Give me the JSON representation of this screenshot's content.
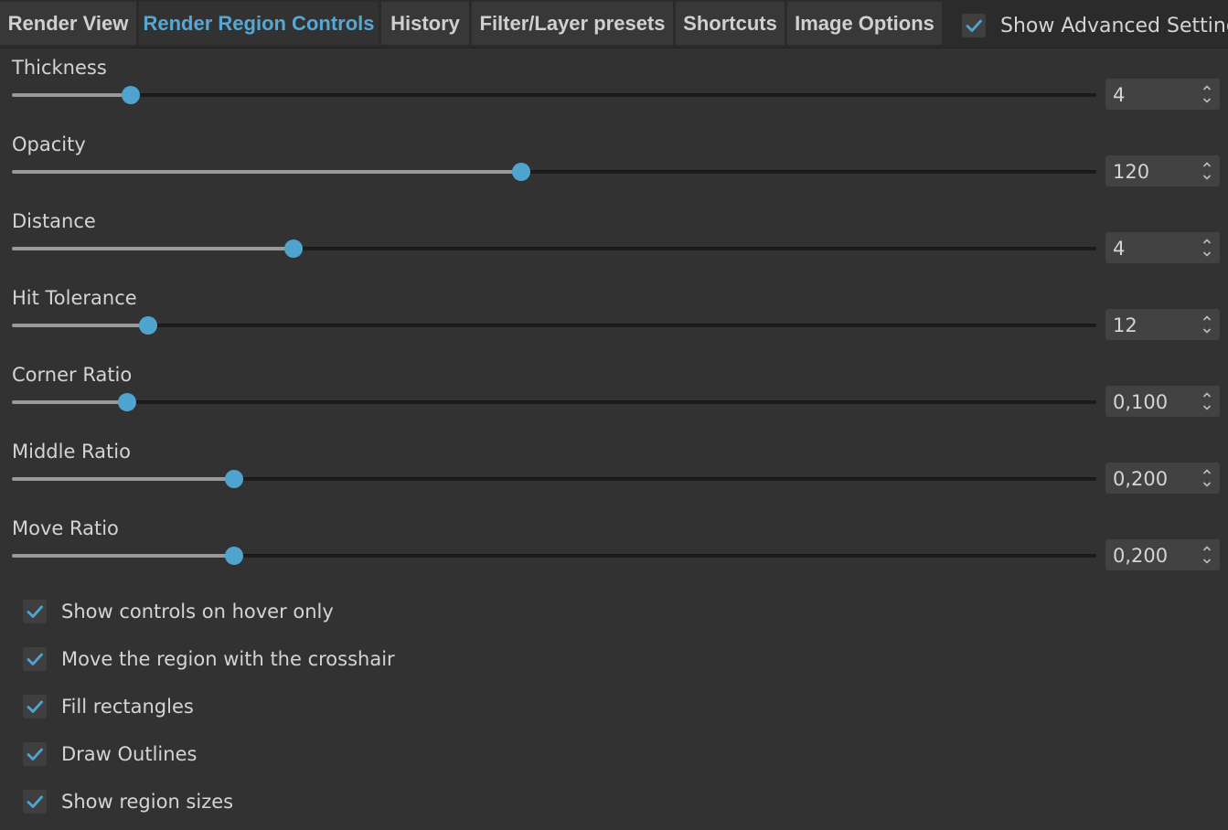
{
  "tabs": [
    {
      "label": "Render View",
      "active": false
    },
    {
      "label": "Render Region Controls",
      "active": true
    },
    {
      "label": "History",
      "active": false
    },
    {
      "label": "Filter/Layer presets",
      "active": false
    },
    {
      "label": "Shortcuts",
      "active": false
    },
    {
      "label": "Image Options",
      "active": false
    }
  ],
  "advanced": {
    "label": "Show Advanced Settings",
    "checked": true
  },
  "controls": [
    {
      "label": "Thickness",
      "value": "4",
      "fraction": 0.11
    },
    {
      "label": "Opacity",
      "value": "120",
      "fraction": 0.47
    },
    {
      "label": "Distance",
      "value": "4",
      "fraction": 0.26
    },
    {
      "label": "Hit Tolerance",
      "value": "12",
      "fraction": 0.126
    },
    {
      "label": "Corner Ratio",
      "value": "0,100",
      "fraction": 0.106
    },
    {
      "label": "Middle Ratio",
      "value": "0,200",
      "fraction": 0.205
    },
    {
      "label": "Move Ratio",
      "value": "0,200",
      "fraction": 0.205
    }
  ],
  "checkboxes": [
    {
      "label": "Show controls on hover only",
      "checked": true
    },
    {
      "label": "Move the region with the crosshair",
      "checked": true
    },
    {
      "label": "Fill rectangles",
      "checked": true
    },
    {
      "label": "Draw Outlines",
      "checked": true
    },
    {
      "label": "Show region sizes",
      "checked": true
    }
  ],
  "colors": {
    "accent": "#4fa3cf",
    "active_tab_text": "#57a7d4",
    "background": "#323232"
  }
}
